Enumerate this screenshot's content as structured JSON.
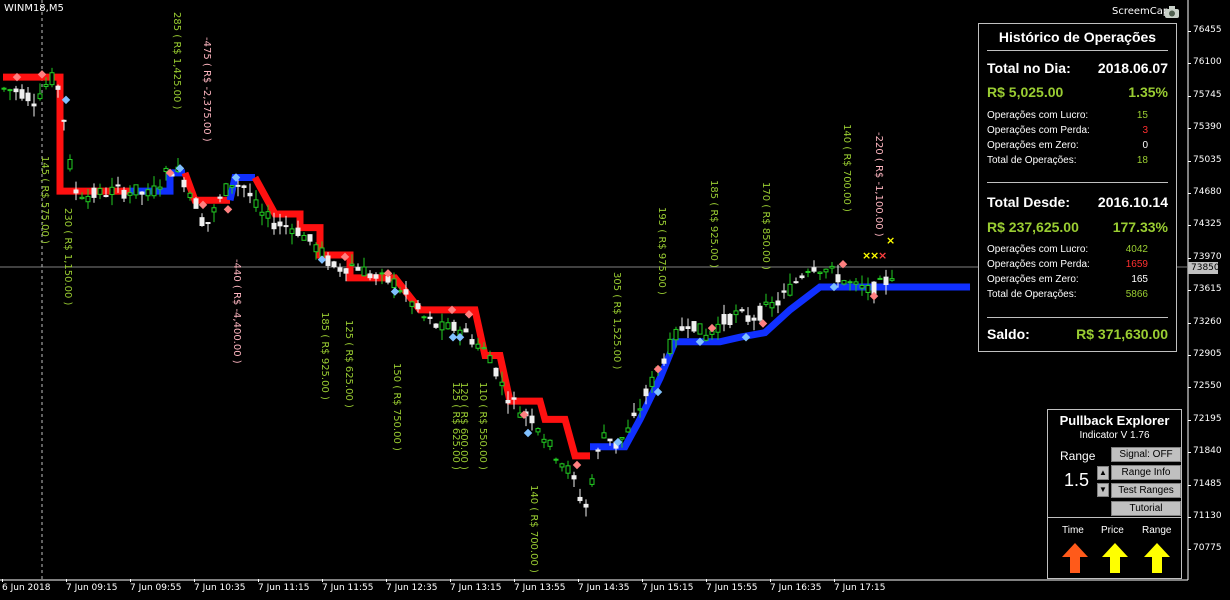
{
  "symbol": "WINM18,M5",
  "screencap_label": "ScreemCap",
  "price_axis": {
    "ticks": [
      "76455",
      "76100",
      "75745",
      "75390",
      "75035",
      "74680",
      "74325",
      "73970",
      "73615",
      "73260",
      "72905",
      "72550",
      "72195",
      "71840",
      "71485",
      "71130",
      "70775"
    ],
    "current": "73850"
  },
  "time_axis": {
    "ticks": [
      "6 Jun 2018",
      "7 Jun 09:15",
      "7 Jun 09:55",
      "7 Jun 10:35",
      "7 Jun 11:15",
      "7 Jun 11:55",
      "7 Jun 12:35",
      "7 Jun 13:15",
      "7 Jun 13:55",
      "7 Jun 14:35",
      "7 Jun 15:15",
      "7 Jun 15:55",
      "7 Jun 16:35",
      "7 Jun 17:15"
    ]
  },
  "trade_labels": [
    {
      "text": "145 ( R$ 575.00 )",
      "kind": "gain"
    },
    {
      "text": "230 ( R$ 1,150.00 )",
      "kind": "gain"
    },
    {
      "text": "285 ( R$ 1,425.00 )",
      "kind": "gain"
    },
    {
      "text": "-475 ( R$ -2,375.00 )",
      "kind": "loss"
    },
    {
      "text": "-440 ( R$ -4,400.00 )",
      "kind": "loss"
    },
    {
      "text": "185 ( R$ 925.00 )",
      "kind": "gain"
    },
    {
      "text": "125 ( R$ 625.00 )",
      "kind": "gain"
    },
    {
      "text": "150 ( R$ 750.00 )",
      "kind": "gain"
    },
    {
      "text": "125 ( R$ 625.00 )",
      "kind": "gain"
    },
    {
      "text": "120 ( R$ 600.00 )",
      "kind": "gain"
    },
    {
      "text": "110 ( R$ 550.00 )",
      "kind": "gain"
    },
    {
      "text": "140 ( R$ 700.00 )",
      "kind": "gain"
    },
    {
      "text": "305 ( R$ 1,525.00 )",
      "kind": "gain"
    },
    {
      "text": "195 ( R$ 975.00 )",
      "kind": "gain"
    },
    {
      "text": "185 ( R$ 925.00 )",
      "kind": "gain"
    },
    {
      "text": "170 ( R$ 850.00 )",
      "kind": "gain"
    },
    {
      "text": "140 ( R$ 700.00 )",
      "kind": "gain"
    },
    {
      "text": "-220 ( R$ -1,100.00 )",
      "kind": "loss"
    }
  ],
  "history": {
    "title": "Histórico de Operações",
    "day_label": "Total no Dia:",
    "day_date": "2018.06.07",
    "day_amount": "R$ 5,025.00",
    "day_pct": "1.35%",
    "day_stats": [
      {
        "label": "Operações com Lucro:",
        "value": "15",
        "color": "#9acd32"
      },
      {
        "label": "Operações com Perda:",
        "value": "3",
        "color": "#ff3030"
      },
      {
        "label": "Operações em Zero:",
        "value": "0",
        "color": "#ffffff"
      },
      {
        "label": "Total de Operações:",
        "value": "18",
        "color": "#9acd32"
      }
    ],
    "since_label": "Total Desde:",
    "since_date": "2016.10.14",
    "since_amount": "R$ 237,625.00",
    "since_pct": "177.33%",
    "since_stats": [
      {
        "label": "Operações com Lucro:",
        "value": "4042",
        "color": "#9acd32"
      },
      {
        "label": "Operações com Perda:",
        "value": "1659",
        "color": "#ff3030"
      },
      {
        "label": "Operações em Zero:",
        "value": "165",
        "color": "#ffffff"
      },
      {
        "label": "Total de Operações:",
        "value": "5866",
        "color": "#9acd32"
      }
    ],
    "balance_label": "Saldo:",
    "balance_value": "R$ 371,630.00"
  },
  "pullback": {
    "title": "Pullback Explorer",
    "version": "Indicator V 1.76",
    "range_label": "Range",
    "range_value": "1.5",
    "buttons": [
      "Signal: OFF",
      "Range Info",
      "Test Ranges",
      "Tutorial"
    ],
    "columns": [
      {
        "label": "Time",
        "color": "#ff5a1a"
      },
      {
        "label": "Price",
        "color": "#ffff00"
      },
      {
        "label": "Range",
        "color": "#ffff00"
      }
    ]
  },
  "colors": {
    "bull_candle": "#22cc22",
    "bear_candle": "#f0f0f0",
    "sell_band": "#ff1010",
    "buy_band": "#1030ff"
  }
}
